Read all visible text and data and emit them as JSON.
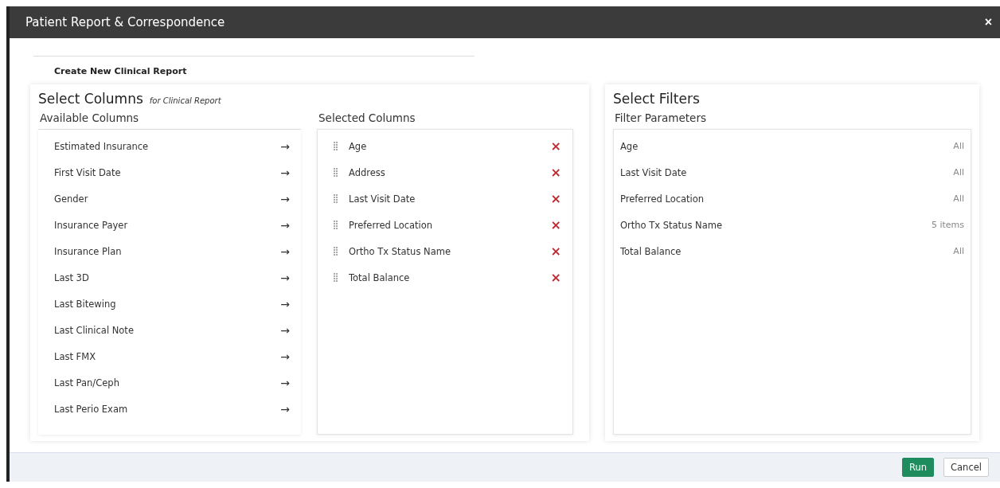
{
  "window": {
    "title": "Patient Report & Correspondence",
    "close": "×"
  },
  "report_title": "Create New Clinical Report",
  "columns_section": {
    "title": "Select Columns",
    "subtitle": "for Clinical Report",
    "available": {
      "title": "Available Columns",
      "items": [
        {
          "label": "Estimated Insurance",
          "action": "→"
        },
        {
          "label": "First Visit Date",
          "action": "→"
        },
        {
          "label": "Gender",
          "action": "→"
        },
        {
          "label": "Insurance Payer",
          "action": "→"
        },
        {
          "label": "Insurance Plan",
          "action": "→"
        },
        {
          "label": "Last 3D",
          "action": "→"
        },
        {
          "label": "Last Bitewing",
          "action": "→"
        },
        {
          "label": "Last Clinical Note",
          "action": "→"
        },
        {
          "label": "Last FMX",
          "action": "→"
        },
        {
          "label": "Last Pan/Ceph",
          "action": "→"
        },
        {
          "label": "Last Perio Exam",
          "action": "→"
        }
      ]
    },
    "selected": {
      "title": "Selected Columns",
      "items": [
        {
          "label": "Age",
          "remove": "×"
        },
        {
          "label": "Address",
          "remove": "×"
        },
        {
          "label": "Last Visit Date",
          "remove": "×"
        },
        {
          "label": "Preferred Location",
          "remove": "×"
        },
        {
          "label": "Ortho Tx Status Name",
          "remove": "×"
        },
        {
          "label": "Total Balance",
          "remove": "×"
        }
      ]
    }
  },
  "filters_section": {
    "title": "Select Filters",
    "subtitle": "Filter Parameters",
    "items": [
      {
        "label": "Age",
        "value": "All"
      },
      {
        "label": "Last Visit Date",
        "value": "All"
      },
      {
        "label": "Preferred Location",
        "value": "All"
      },
      {
        "label": "Ortho Tx Status Name",
        "value": "5 items"
      },
      {
        "label": "Total Balance",
        "value": "All"
      }
    ]
  },
  "buttons": [
    {
      "label": "Run",
      "kind": "primary"
    },
    {
      "label": "Cancel",
      "kind": "secondary"
    }
  ]
}
